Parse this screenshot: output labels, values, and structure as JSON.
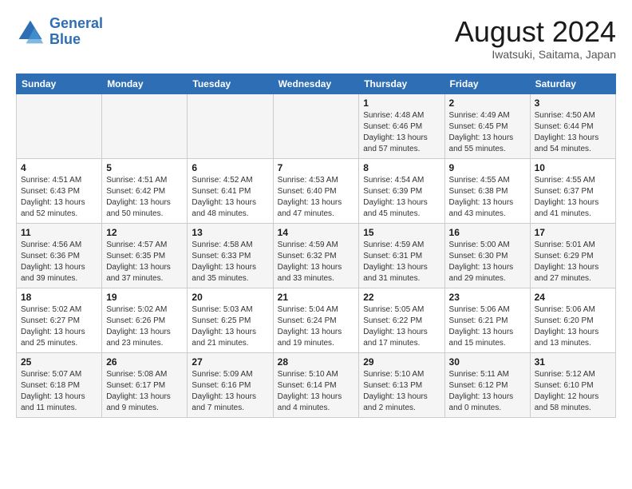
{
  "logo": {
    "line1": "General",
    "line2": "Blue"
  },
  "title": "August 2024",
  "subtitle": "Iwatsuki, Saitama, Japan",
  "days_of_week": [
    "Sunday",
    "Monday",
    "Tuesday",
    "Wednesday",
    "Thursday",
    "Friday",
    "Saturday"
  ],
  "weeks": [
    [
      {
        "day": "",
        "info": ""
      },
      {
        "day": "",
        "info": ""
      },
      {
        "day": "",
        "info": ""
      },
      {
        "day": "",
        "info": ""
      },
      {
        "day": "1",
        "info": "Sunrise: 4:48 AM\nSunset: 6:46 PM\nDaylight: 13 hours and 57 minutes."
      },
      {
        "day": "2",
        "info": "Sunrise: 4:49 AM\nSunset: 6:45 PM\nDaylight: 13 hours and 55 minutes."
      },
      {
        "day": "3",
        "info": "Sunrise: 4:50 AM\nSunset: 6:44 PM\nDaylight: 13 hours and 54 minutes."
      }
    ],
    [
      {
        "day": "4",
        "info": "Sunrise: 4:51 AM\nSunset: 6:43 PM\nDaylight: 13 hours and 52 minutes."
      },
      {
        "day": "5",
        "info": "Sunrise: 4:51 AM\nSunset: 6:42 PM\nDaylight: 13 hours and 50 minutes."
      },
      {
        "day": "6",
        "info": "Sunrise: 4:52 AM\nSunset: 6:41 PM\nDaylight: 13 hours and 48 minutes."
      },
      {
        "day": "7",
        "info": "Sunrise: 4:53 AM\nSunset: 6:40 PM\nDaylight: 13 hours and 47 minutes."
      },
      {
        "day": "8",
        "info": "Sunrise: 4:54 AM\nSunset: 6:39 PM\nDaylight: 13 hours and 45 minutes."
      },
      {
        "day": "9",
        "info": "Sunrise: 4:55 AM\nSunset: 6:38 PM\nDaylight: 13 hours and 43 minutes."
      },
      {
        "day": "10",
        "info": "Sunrise: 4:55 AM\nSunset: 6:37 PM\nDaylight: 13 hours and 41 minutes."
      }
    ],
    [
      {
        "day": "11",
        "info": "Sunrise: 4:56 AM\nSunset: 6:36 PM\nDaylight: 13 hours and 39 minutes."
      },
      {
        "day": "12",
        "info": "Sunrise: 4:57 AM\nSunset: 6:35 PM\nDaylight: 13 hours and 37 minutes."
      },
      {
        "day": "13",
        "info": "Sunrise: 4:58 AM\nSunset: 6:33 PM\nDaylight: 13 hours and 35 minutes."
      },
      {
        "day": "14",
        "info": "Sunrise: 4:59 AM\nSunset: 6:32 PM\nDaylight: 13 hours and 33 minutes."
      },
      {
        "day": "15",
        "info": "Sunrise: 4:59 AM\nSunset: 6:31 PM\nDaylight: 13 hours and 31 minutes."
      },
      {
        "day": "16",
        "info": "Sunrise: 5:00 AM\nSunset: 6:30 PM\nDaylight: 13 hours and 29 minutes."
      },
      {
        "day": "17",
        "info": "Sunrise: 5:01 AM\nSunset: 6:29 PM\nDaylight: 13 hours and 27 minutes."
      }
    ],
    [
      {
        "day": "18",
        "info": "Sunrise: 5:02 AM\nSunset: 6:27 PM\nDaylight: 13 hours and 25 minutes."
      },
      {
        "day": "19",
        "info": "Sunrise: 5:02 AM\nSunset: 6:26 PM\nDaylight: 13 hours and 23 minutes."
      },
      {
        "day": "20",
        "info": "Sunrise: 5:03 AM\nSunset: 6:25 PM\nDaylight: 13 hours and 21 minutes."
      },
      {
        "day": "21",
        "info": "Sunrise: 5:04 AM\nSunset: 6:24 PM\nDaylight: 13 hours and 19 minutes."
      },
      {
        "day": "22",
        "info": "Sunrise: 5:05 AM\nSunset: 6:22 PM\nDaylight: 13 hours and 17 minutes."
      },
      {
        "day": "23",
        "info": "Sunrise: 5:06 AM\nSunset: 6:21 PM\nDaylight: 13 hours and 15 minutes."
      },
      {
        "day": "24",
        "info": "Sunrise: 5:06 AM\nSunset: 6:20 PM\nDaylight: 13 hours and 13 minutes."
      }
    ],
    [
      {
        "day": "25",
        "info": "Sunrise: 5:07 AM\nSunset: 6:18 PM\nDaylight: 13 hours and 11 minutes."
      },
      {
        "day": "26",
        "info": "Sunrise: 5:08 AM\nSunset: 6:17 PM\nDaylight: 13 hours and 9 minutes."
      },
      {
        "day": "27",
        "info": "Sunrise: 5:09 AM\nSunset: 6:16 PM\nDaylight: 13 hours and 7 minutes."
      },
      {
        "day": "28",
        "info": "Sunrise: 5:10 AM\nSunset: 6:14 PM\nDaylight: 13 hours and 4 minutes."
      },
      {
        "day": "29",
        "info": "Sunrise: 5:10 AM\nSunset: 6:13 PM\nDaylight: 13 hours and 2 minutes."
      },
      {
        "day": "30",
        "info": "Sunrise: 5:11 AM\nSunset: 6:12 PM\nDaylight: 13 hours and 0 minutes."
      },
      {
        "day": "31",
        "info": "Sunrise: 5:12 AM\nSunset: 6:10 PM\nDaylight: 12 hours and 58 minutes."
      }
    ]
  ]
}
